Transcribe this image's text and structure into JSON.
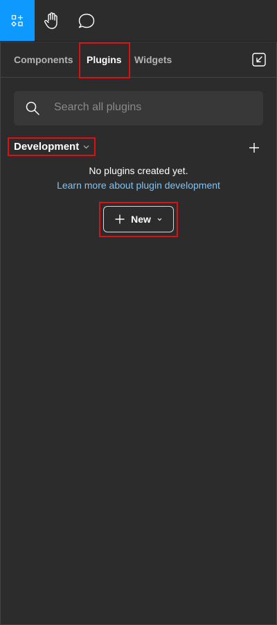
{
  "toolbar": {
    "tools": [
      {
        "icon": "assets-icon",
        "active": true
      },
      {
        "icon": "hand-icon",
        "active": false
      },
      {
        "icon": "comment-icon",
        "active": false
      }
    ]
  },
  "tabs": [
    {
      "label": "Components",
      "active": false
    },
    {
      "label": "Plugins",
      "active": true
    },
    {
      "label": "Widgets",
      "active": false
    }
  ],
  "collapse_icon": "collapse-panel-icon",
  "search": {
    "placeholder": "Search all plugins",
    "value": ""
  },
  "development": {
    "title": "Development",
    "empty_text": "No plugins created yet.",
    "learn_link": "Learn more about plugin development",
    "new_button_label": "New"
  },
  "colors": {
    "accent": "#0d99ff",
    "background": "#2c2c2c",
    "link": "#7cc4f8",
    "highlight": "#e01010"
  }
}
